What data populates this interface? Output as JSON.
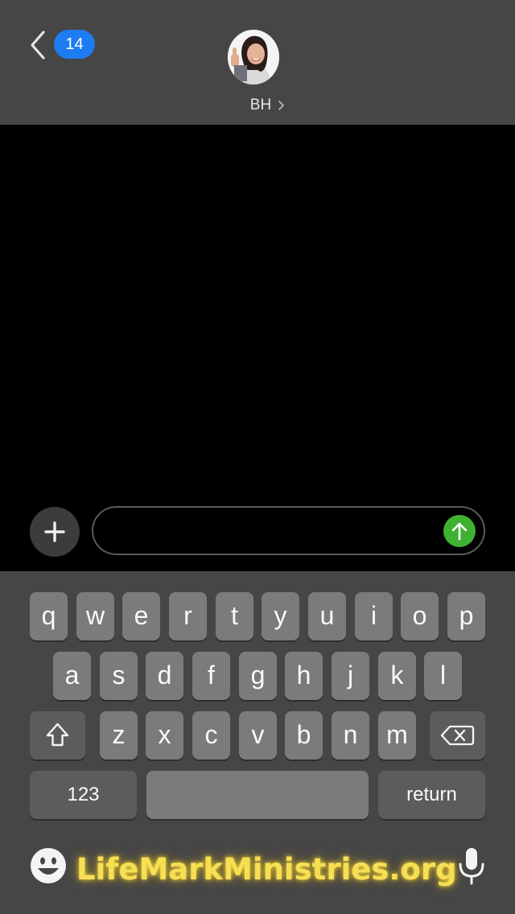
{
  "header": {
    "back_badge": "14",
    "contact_name": "BH"
  },
  "composer": {
    "message_value": ""
  },
  "keyboard": {
    "row1": [
      "q",
      "w",
      "e",
      "r",
      "t",
      "y",
      "u",
      "i",
      "o",
      "p"
    ],
    "row2": [
      "a",
      "s",
      "d",
      "f",
      "g",
      "h",
      "j",
      "k",
      "l"
    ],
    "row3": [
      "z",
      "x",
      "c",
      "v",
      "b",
      "n",
      "m"
    ],
    "numbers_label": "123",
    "return_label": "return"
  },
  "watermark": "LifeMarkMinistries.org",
  "colors": {
    "header_bg": "#464646",
    "badge_blue": "#1e7cf2",
    "send_green": "#3fb132",
    "key_gray": "#7b7b7b",
    "watermark_yellow": "#f7df54"
  },
  "icons": {
    "back": "chevron-left-icon",
    "plus": "plus-icon",
    "send": "arrow-up-icon",
    "shift": "shift-icon",
    "delete": "backspace-icon",
    "emoji": "emoji-icon",
    "mic": "microphone-icon"
  }
}
